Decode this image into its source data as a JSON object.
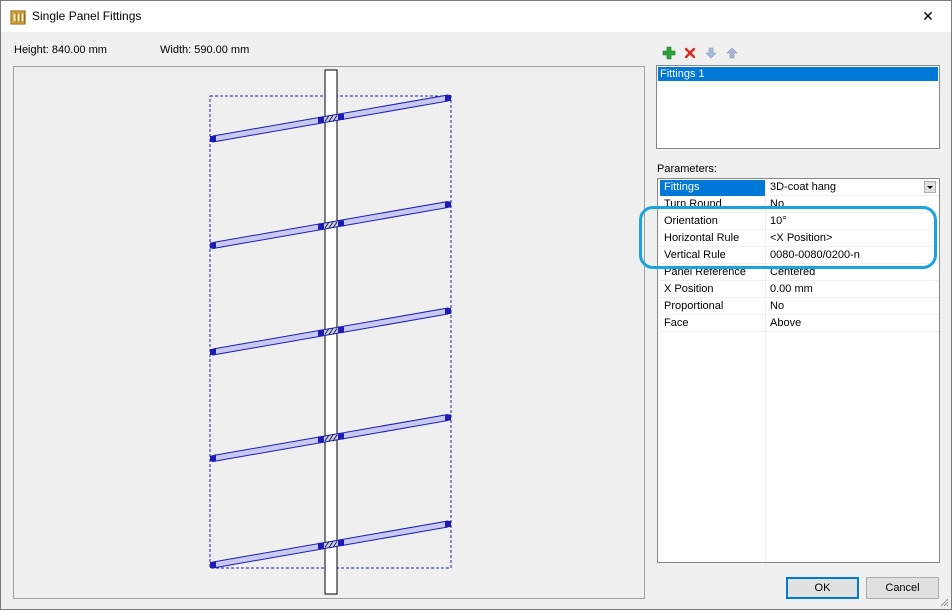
{
  "window": {
    "title": "Single Panel Fittings",
    "close_glyph": "✕"
  },
  "dims": {
    "height": "Height: 840.00 mm",
    "width": "Width: 590.00 mm"
  },
  "toolbar": {
    "icons": [
      "add-icon",
      "delete-icon",
      "move-down-icon",
      "move-up-icon"
    ]
  },
  "fittings_list": {
    "items": [
      "Fittings 1"
    ]
  },
  "parameters": {
    "label": "Parameters:",
    "rows": [
      {
        "name": "Fittings",
        "value": "3D-coat hang"
      },
      {
        "name": "Turn Round",
        "value": "No"
      },
      {
        "name": "Orientation",
        "value": "10°"
      },
      {
        "name": "Horizontal Rule",
        "value": "<X Position>"
      },
      {
        "name": "Vertical Rule",
        "value": "0080-0080/0200-n"
      },
      {
        "name": "Panel Reference",
        "value": "Centered"
      },
      {
        "name": "X Position",
        "value": "0.00 mm"
      },
      {
        "name": "Proportional",
        "value": "No"
      },
      {
        "name": "Face",
        "value": "Above"
      }
    ]
  },
  "buttons": {
    "ok": "OK",
    "cancel": "Cancel"
  },
  "colors": {
    "accent": "#0078d7",
    "highlight": "#1aa3dc",
    "fitting": "#c8c8f0",
    "fitting_edge": "#1c1cb4"
  },
  "fittings_count": 5
}
